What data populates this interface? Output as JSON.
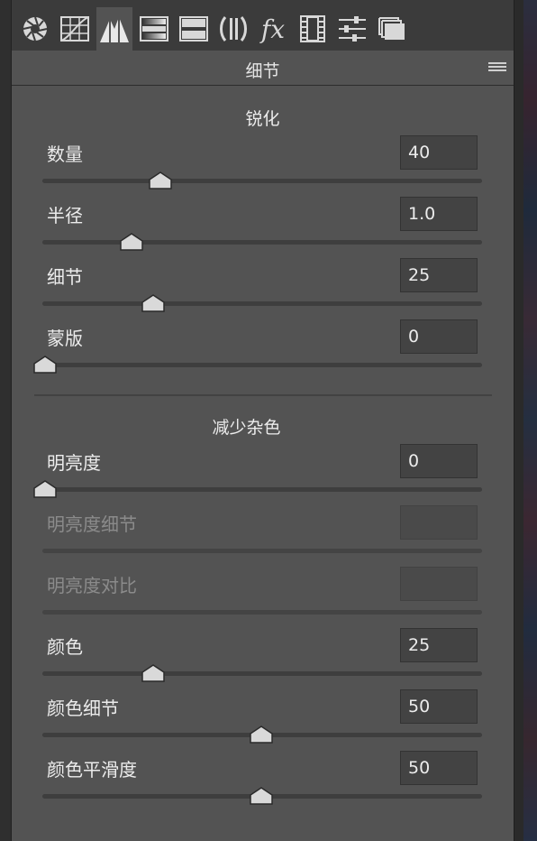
{
  "toolbar": {
    "tools": [
      {
        "name": "basic-aperture-icon",
        "active": false
      },
      {
        "name": "tone-curve-icon",
        "active": false
      },
      {
        "name": "detail-icon",
        "active": true
      },
      {
        "name": "hsl-icon",
        "active": false
      },
      {
        "name": "split-toning-icon",
        "active": false
      },
      {
        "name": "lens-correction-icon",
        "active": false
      },
      {
        "name": "effects-fx-icon",
        "active": false
      },
      {
        "name": "camera-calibration-icon",
        "active": false
      },
      {
        "name": "presets-sliders-icon",
        "active": false
      },
      {
        "name": "snapshots-icon",
        "active": false
      }
    ],
    "fx_label": "fx"
  },
  "panel": {
    "title": "细节"
  },
  "sharpening": {
    "title": "锐化",
    "rows": [
      {
        "label": "数量",
        "value": "40",
        "fraction": 0.267,
        "disabled": false
      },
      {
        "label": "半径",
        "value": "1.0",
        "fraction": 0.2,
        "disabled": false
      },
      {
        "label": "细节",
        "value": "25",
        "fraction": 0.25,
        "disabled": false
      },
      {
        "label": "蒙版",
        "value": "0",
        "fraction": 0.0,
        "disabled": false
      }
    ]
  },
  "noise_reduction": {
    "title": "减少杂色",
    "rows": [
      {
        "label": "明亮度",
        "value": "0",
        "fraction": 0.0,
        "disabled": false
      },
      {
        "label": "明亮度细节",
        "value": "",
        "fraction": null,
        "disabled": true
      },
      {
        "label": "明亮度对比",
        "value": "",
        "fraction": null,
        "disabled": true
      },
      {
        "label": "颜色",
        "value": "25",
        "fraction": 0.25,
        "disabled": false
      },
      {
        "label": "颜色细节",
        "value": "50",
        "fraction": 0.5,
        "disabled": false
      },
      {
        "label": "颜色平滑度",
        "value": "50",
        "fraction": 0.5,
        "disabled": false
      }
    ]
  },
  "colors": {
    "panel_bg": "#535353",
    "toolbar_bg": "#3b3b3b",
    "text": "#ececec",
    "disabled_text": "#8b8b8b",
    "thumb": "#d9d9d9"
  }
}
